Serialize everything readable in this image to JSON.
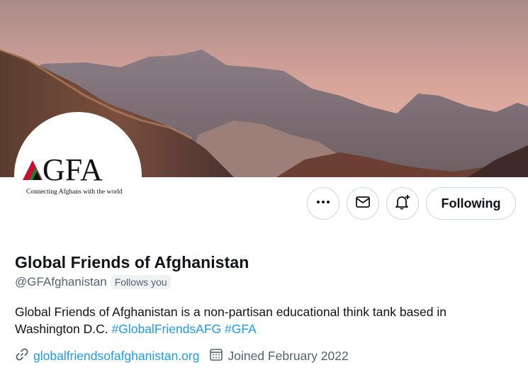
{
  "profile": {
    "avatar": {
      "logo_text": "GFA",
      "tagline": "Connecting Afghans with the world"
    },
    "display_name": "Global Friends of Afghanistan",
    "handle": "@GFAfghanistan",
    "follows_you": "Follows you",
    "bio_text": "Global Friends of Afghanistan is a non-partisan educational think tank based in Washington D.C. ",
    "bio_hashtags": [
      "#GlobalFriendsAFG",
      "#GFA"
    ],
    "website": "globalfriendsofafghanistan.org",
    "joined": "Joined February 2022"
  },
  "actions": {
    "more_icon": "more-horizontal-icon",
    "message_icon": "envelope-icon",
    "notify_icon": "bell-plus-icon",
    "follow_label": "Following"
  },
  "colors": {
    "link": "#1d9bf0",
    "text": "#0f1419",
    "secondary": "#536471",
    "border": "#cfd9de"
  }
}
